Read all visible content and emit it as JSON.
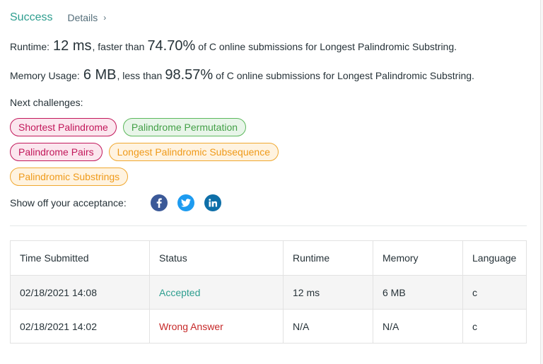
{
  "header": {
    "status": "Success",
    "details_label": "Details",
    "details_chevron": "›"
  },
  "runtime": {
    "label": "Runtime:",
    "value": "12 ms",
    "mid_text": ", faster than",
    "percent": "74.70%",
    "suffix": "of C online submissions for Longest Palindromic Substring."
  },
  "memory": {
    "label": "Memory Usage:",
    "value": "6 MB",
    "mid_text": ", less than",
    "percent": "98.57%",
    "suffix": "of C online submissions for Longest Palindromic Substring."
  },
  "next_challenges": {
    "label": "Next challenges:",
    "items": [
      {
        "label": "Shortest Palindrome",
        "difficulty": "hard"
      },
      {
        "label": "Palindrome Permutation",
        "difficulty": "easy"
      },
      {
        "label": "Palindrome Pairs",
        "difficulty": "hard"
      },
      {
        "label": "Longest Palindromic Subsequence",
        "difficulty": "medium"
      },
      {
        "label": "Palindromic Substrings",
        "difficulty": "medium"
      }
    ]
  },
  "share": {
    "label": "Show off your acceptance:",
    "icons": [
      "facebook-icon",
      "twitter-icon",
      "linkedin-icon"
    ]
  },
  "colors": {
    "success": "#2e9e8f",
    "wrong": "#c62828",
    "hard": "#c2185b",
    "easy": "#43a047",
    "medium": "#ef9a1a"
  },
  "table": {
    "headers": [
      "Time Submitted",
      "Status",
      "Runtime",
      "Memory",
      "Language"
    ],
    "rows": [
      {
        "time": "02/18/2021 14:08",
        "status": "Accepted",
        "runtime": "12 ms",
        "memory": "6 MB",
        "language": "c"
      },
      {
        "time": "02/18/2021 14:02",
        "status": "Wrong Answer",
        "runtime": "N/A",
        "memory": "N/A",
        "language": "c"
      }
    ]
  }
}
